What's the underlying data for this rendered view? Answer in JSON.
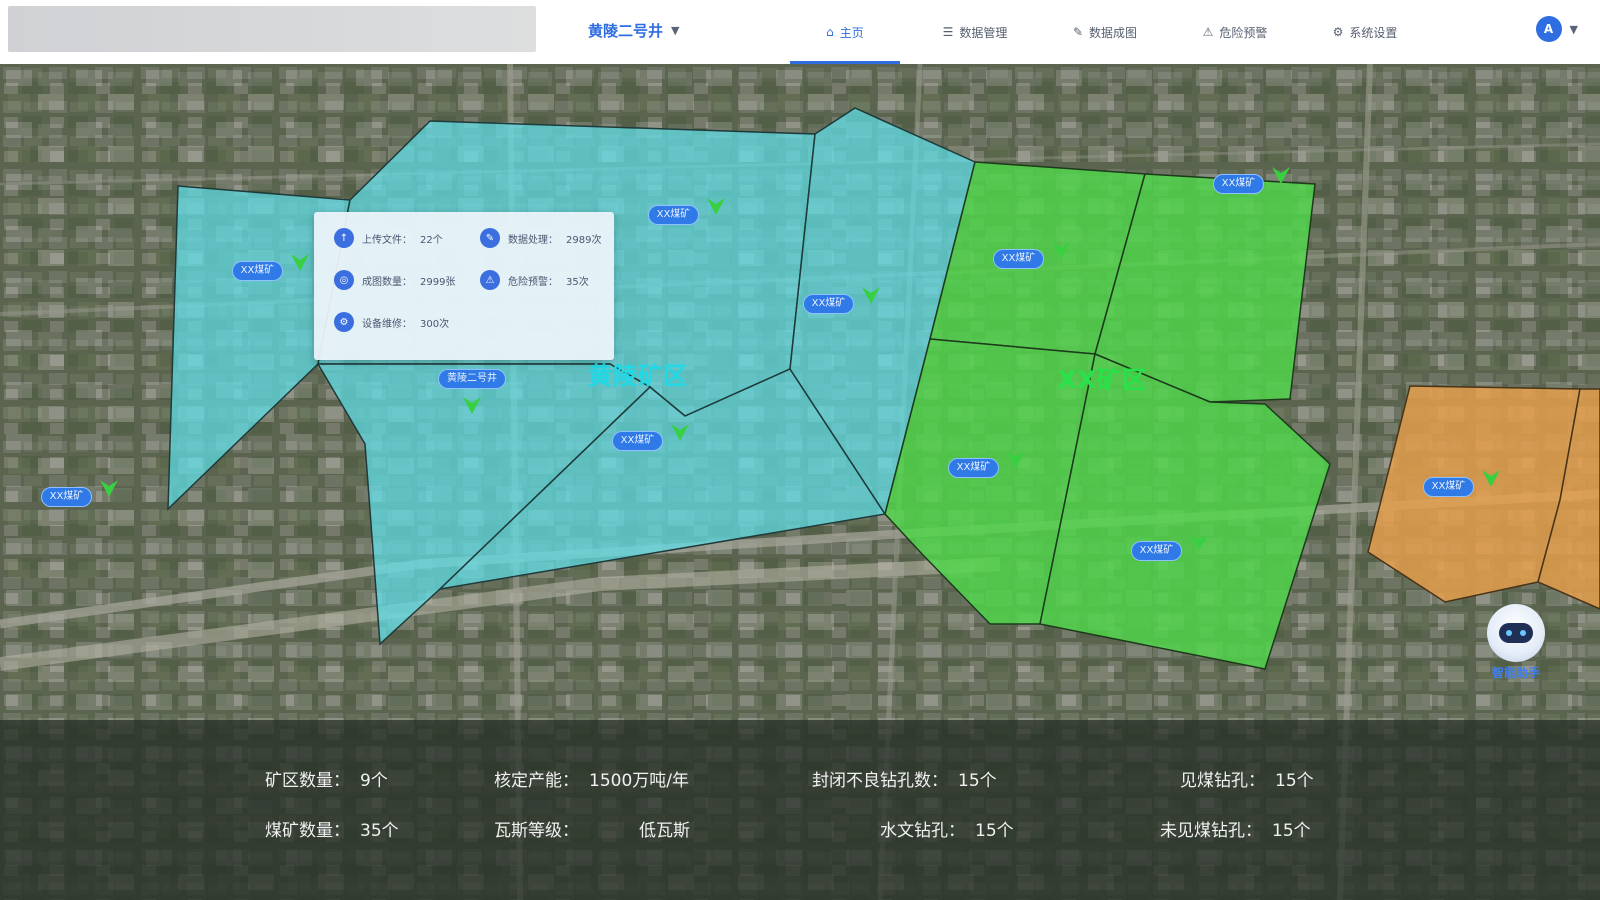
{
  "header": {
    "mine_selector": "黄陵二号井",
    "nav": [
      {
        "label": "主页",
        "icon": "home-icon",
        "active": true
      },
      {
        "label": "数据管理",
        "icon": "data-icon",
        "active": false
      },
      {
        "label": "数据成图",
        "icon": "pen-icon",
        "active": false
      },
      {
        "label": "危险预警",
        "icon": "warning-icon",
        "active": false
      },
      {
        "label": "系统设置",
        "icon": "settings-icon",
        "active": false
      }
    ],
    "user_avatar": "A"
  },
  "map": {
    "areas": [
      {
        "label": "黄陵矿区",
        "color": "#5fe0ea"
      },
      {
        "label": "XX矿区",
        "color": "#4fd84a"
      },
      {
        "label": "",
        "color": "#e9a04c"
      }
    ],
    "markers": [
      {
        "label": "XX煤矿"
      },
      {
        "label": "XX煤矿"
      },
      {
        "label": "黄陵二号井"
      },
      {
        "label": "XX煤矿"
      },
      {
        "label": "XX煤矿"
      },
      {
        "label": "XX煤矿"
      },
      {
        "label": "XX煤矿"
      },
      {
        "label": "XX煤矿"
      },
      {
        "label": "XX煤矿"
      },
      {
        "label": "XX煤矿"
      },
      {
        "label": "XX煤矿"
      }
    ],
    "info_card": [
      {
        "icon": "upload-icon",
        "label": "上传文件：",
        "value": "22个"
      },
      {
        "icon": "data-icon",
        "label": "数据处理：",
        "value": "2989次"
      },
      {
        "icon": "map-icon",
        "label": "成图数量：",
        "value": "2999张"
      },
      {
        "icon": "warning-icon",
        "label": "危险预警：",
        "value": "35次"
      },
      {
        "icon": "device-icon",
        "label": "设备维修：",
        "value": "300次"
      }
    ],
    "assistant_label": "智能助手"
  },
  "stats": {
    "row1": [
      {
        "label": "矿区数量：",
        "value": "9个"
      },
      {
        "label": "核定产能：",
        "value": "1500万吨/年"
      },
      {
        "label": "封闭不良钻孔数：",
        "value": "15个"
      },
      {
        "label": "见煤钻孔：",
        "value": "15个"
      }
    ],
    "row2": [
      {
        "label": "煤矿数量：",
        "value": "35个"
      },
      {
        "label": "瓦斯等级：",
        "value": "低瓦斯"
      },
      {
        "label": "水文钻孔：",
        "value": "15个"
      },
      {
        "label": "未见煤钻孔：",
        "value": "15个"
      }
    ]
  },
  "colors": {
    "accent": "#2f6ee0",
    "marker_pin": "#38d040"
  }
}
